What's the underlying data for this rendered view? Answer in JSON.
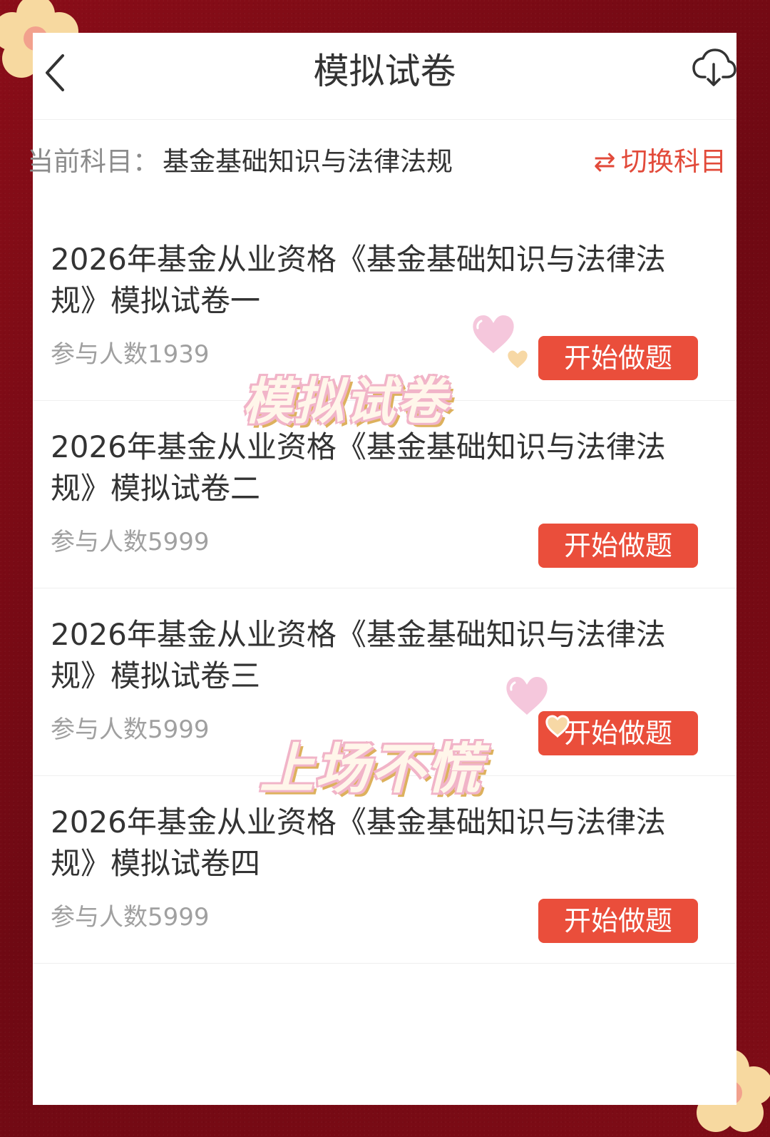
{
  "header": {
    "title": "模拟试卷"
  },
  "subject": {
    "label": "当前科目：",
    "value": "基金基础知识与法律法规",
    "switch_label": "切换科目"
  },
  "exams": [
    {
      "title": "2026年基金从业资格《基金基础知识与法律法规》模拟试卷一",
      "participants": "参与人数1939",
      "button": "开始做题"
    },
    {
      "title": "2026年基金从业资格《基金基础知识与法律法规》模拟试卷二",
      "participants": "参与人数5999",
      "button": "开始做题"
    },
    {
      "title": "2026年基金从业资格《基金基础知识与法律法规》模拟试卷三",
      "participants": "参与人数5999",
      "button": "开始做题"
    },
    {
      "title": "2026年基金从业资格《基金基础知识与法律法规》模拟试卷四",
      "participants": "参与人数5999",
      "button": "开始做题"
    }
  ],
  "stickers": {
    "top": "模拟试卷",
    "bottom": "上场不慌"
  },
  "colors": {
    "frame": "#7a0b14",
    "accent": "#ea4e3b",
    "switch": "#e24a3a",
    "sticker_outline": "#f1b4c8"
  },
  "icons": {
    "back": "chevron-left-icon",
    "download": "cloud-download-icon",
    "switch": "swap-icon",
    "heart": "heart-icon",
    "flower": "flower-icon"
  }
}
